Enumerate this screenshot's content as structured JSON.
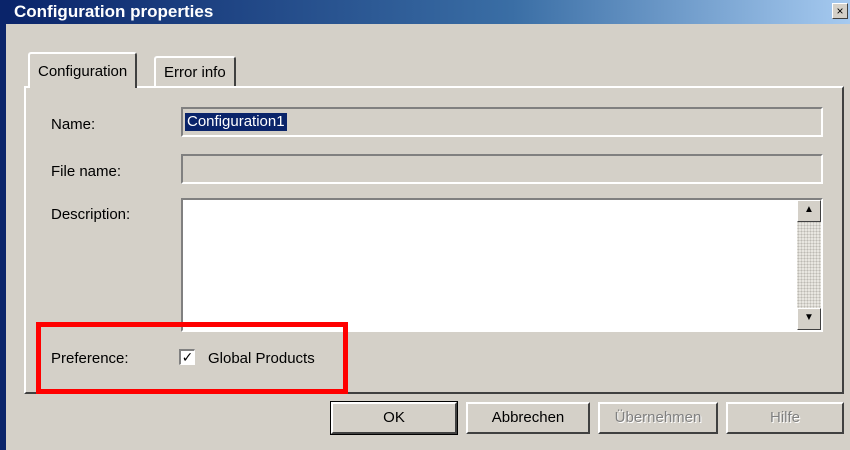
{
  "window": {
    "title": "Configuration properties",
    "close_glyph": "×"
  },
  "tabs": [
    {
      "label": "Configuration"
    },
    {
      "label": "Error info"
    }
  ],
  "form": {
    "name_label": "Name:",
    "name_value": "Configuration1",
    "filename_label": "File name:",
    "filename_value": "",
    "description_label": "Description:",
    "description_value": "",
    "preference_label": "Preference:",
    "global_products_label": "Global Products",
    "global_products_checked": true
  },
  "buttons": {
    "ok": "OK",
    "cancel": "Abbrechen",
    "apply": "Übernehmen",
    "help": "Hilfe"
  },
  "colors": {
    "highlight": "#ff0000",
    "titlebar": "#0a246a"
  }
}
